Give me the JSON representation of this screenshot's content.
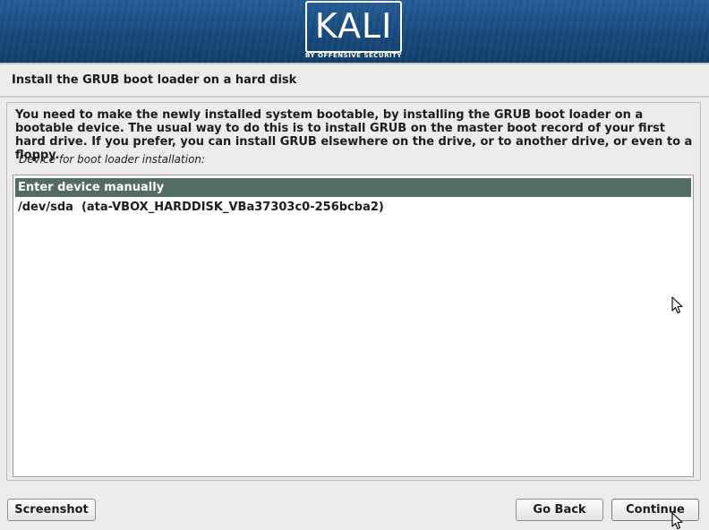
{
  "banner": {
    "brand": "KALI",
    "tagline": "BY OFFENSIVE SECURITY"
  },
  "page": {
    "title": "Install the GRUB boot loader on a hard disk",
    "description": "You need to make the newly installed system bootable, by installing the GRUB boot loader on a bootable device. The usual way to do this is to install GRUB on the master boot record of your first hard drive. If you prefer, you can install GRUB elsewhere on the drive, or to another drive, or even to a floppy.",
    "field_label": "Device for boot loader installation:"
  },
  "device_list": {
    "items": [
      {
        "label": "Enter device manually",
        "selected": true
      },
      {
        "label": "/dev/sda  (ata-VBOX_HARDDISK_VBa37303c0-256bcba2)",
        "selected": false
      }
    ]
  },
  "buttons": {
    "screenshot": "Screenshot",
    "go_back": "Go Back",
    "continue": "Continue"
  },
  "colors": {
    "banner": "#14467a",
    "selection": "#536b65",
    "background": "#edeceb"
  }
}
